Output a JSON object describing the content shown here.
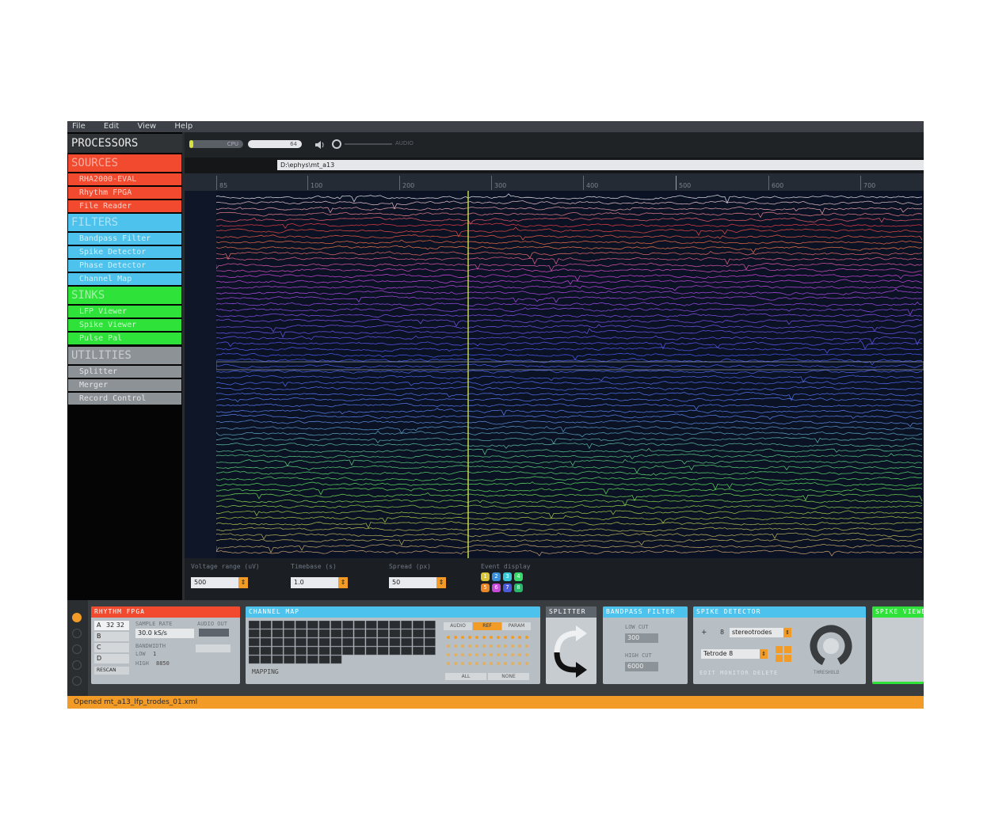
{
  "menu": [
    "File",
    "Edit",
    "View",
    "Help"
  ],
  "processors": {
    "title": "PROCESSORS",
    "categories": [
      {
        "label": "SOURCES",
        "color": "#f24a2e",
        "items": [
          "RHA2000-EVAL",
          "Rhythm FPGA",
          "File Reader"
        ]
      },
      {
        "label": "FILTERS",
        "color": "#4cc2ec",
        "items": [
          "Bandpass Filter",
          "Spike Detector",
          "Phase Detector",
          "Channel Map"
        ]
      },
      {
        "label": "SINKS",
        "color": "#2ee23a",
        "items": [
          "LFP Viewer",
          "Spike Viewer",
          "Pulse Pal"
        ]
      },
      {
        "label": "UTILITIES",
        "color": "#8d9296",
        "items": [
          "Splitter",
          "Merger",
          "Record Control"
        ]
      }
    ]
  },
  "topbar": {
    "cpu_label": "CPU",
    "disk_label": "64",
    "audio_label": "AUDIO"
  },
  "path": "D:\\ephys\\mt_a13",
  "timeline": {
    "ticks": [
      "85",
      "100",
      "200",
      "300",
      "400",
      "500",
      "600",
      "700"
    ]
  },
  "controls": {
    "voltage_label": "Voltage range (uV)",
    "voltage_value": "500",
    "timebase_label": "Timebase (s)",
    "timebase_value": "1.0",
    "spread_label": "Spread (px)",
    "spread_value": "50",
    "event_label": "Event display",
    "events": [
      {
        "n": "1",
        "color": "#d8c63a"
      },
      {
        "n": "2",
        "color": "#3a8fd8"
      },
      {
        "n": "3",
        "color": "#3ac8d8"
      },
      {
        "n": "4",
        "color": "#3ad86a"
      },
      {
        "n": "5",
        "color": "#e8862a"
      },
      {
        "n": "6",
        "color": "#c84ad8"
      },
      {
        "n": "7",
        "color": "#4a5ad8"
      },
      {
        "n": "8",
        "color": "#2ab86a"
      }
    ]
  },
  "editors": {
    "rhythm": {
      "title": "RHYTHM FPGA",
      "ports": [
        "A",
        "B",
        "C",
        "D"
      ],
      "port_a_value": "32 32",
      "sample_rate_label": "SAMPLE RATE",
      "sample_rate_value": "30.0 kS/s",
      "bandwidth_label": "BANDWIDTH",
      "low_label": "LOW",
      "low_value": "1",
      "high_label": "HIGH",
      "high_value": "8850",
      "audio_out_label": "AUDIO OUT",
      "rescan_label": "RESCAN"
    },
    "channel_map": {
      "title": "CHANNEL MAP",
      "mapping_label": "MAPPING",
      "tabs": [
        "AUDIO",
        "REF",
        "PARAM"
      ],
      "all_label": "ALL",
      "none_label": "NONE"
    },
    "splitter": {
      "title": "SPLITTER"
    },
    "bandpass": {
      "title": "BANDPASS FILTER",
      "low_cut_label": "LOW CUT",
      "low_cut_value": "300",
      "high_cut_label": "HIGH CUT",
      "high_cut_value": "6000"
    },
    "spike_detector": {
      "title": "SPIKE DETECTOR",
      "count_value": "8",
      "type_value": "stereotrodes",
      "electrode_value": "Tetrode 8",
      "threshold_label": "THRESHOLD",
      "actions": "EDIT MONITOR DELETE"
    },
    "spike_viewer": {
      "title": "SPIKE VIEWER"
    }
  },
  "status": "Opened mt_a13_lfp_trodes_01.xml"
}
